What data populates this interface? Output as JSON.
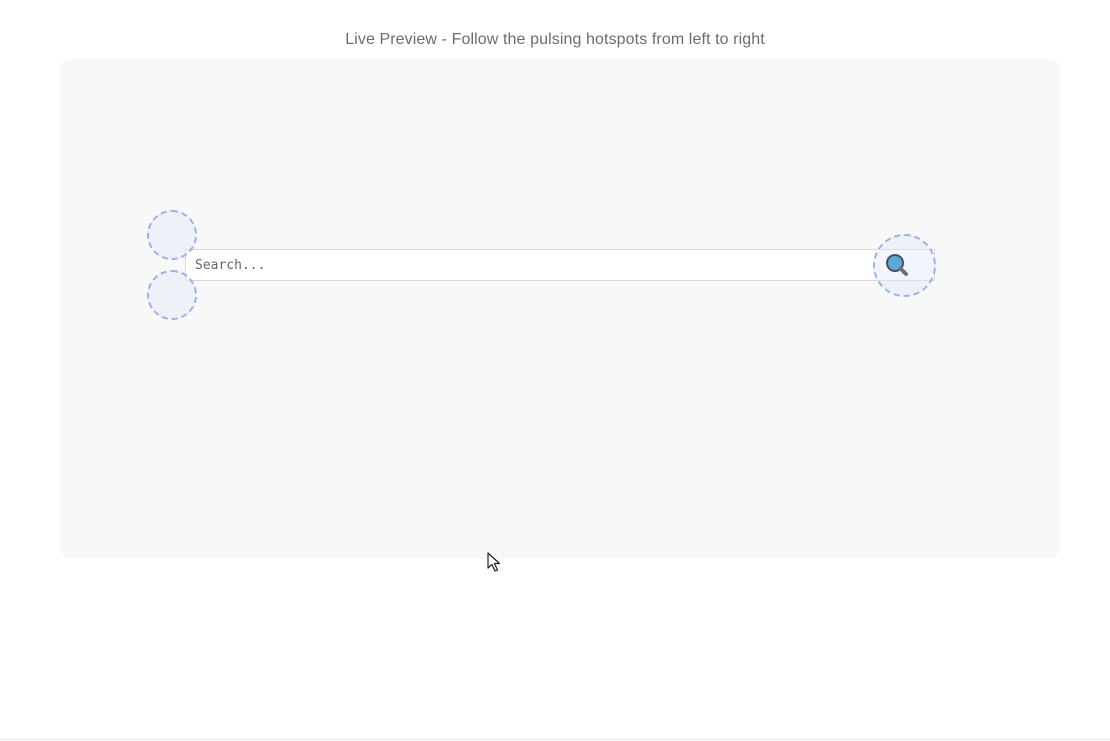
{
  "preview": {
    "title": "Live Preview - Follow the pulsing hotspots from left to right"
  },
  "search": {
    "placeholder": "Search...",
    "value": "",
    "button_icon": "magnifying-glass-icon"
  },
  "hotspots": [
    {
      "id": "hotspot-1"
    },
    {
      "id": "hotspot-2"
    },
    {
      "id": "hotspot-3"
    }
  ],
  "colors": {
    "hotspot_border": "#9fb0ee",
    "preview_background": "#f8f8f9",
    "icon_lens": "#5aa9d8"
  },
  "cursor_icon": "mouse-pointer-icon"
}
